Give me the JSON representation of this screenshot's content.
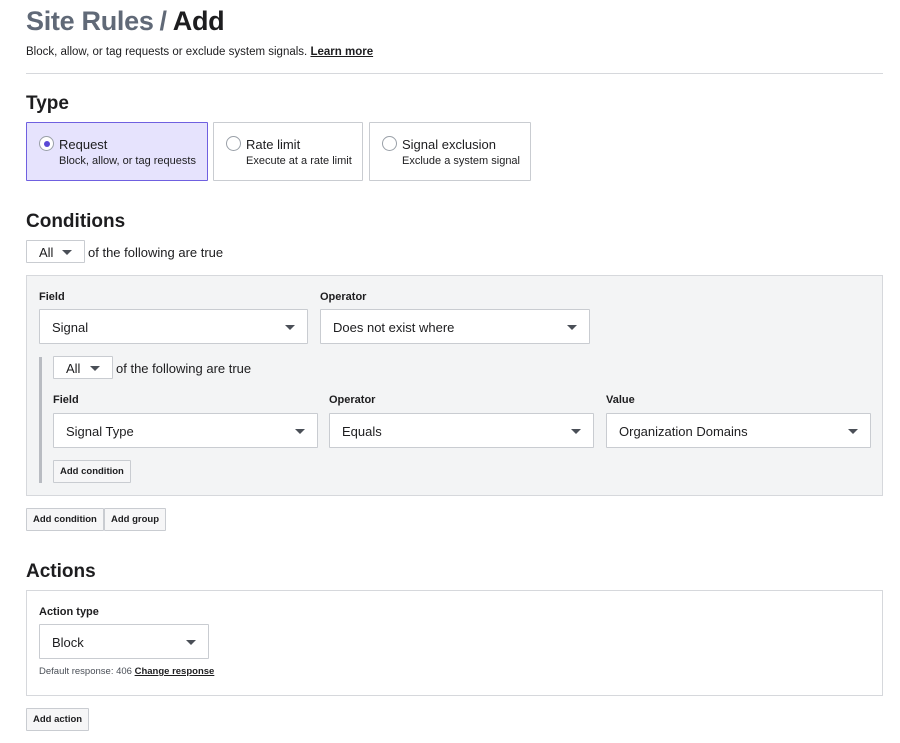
{
  "header": {
    "breadcrumb": "Site Rules",
    "separator": "/",
    "current": "Add",
    "description": "Block, allow, or tag requests or exclude system signals.",
    "learn_more": "Learn more"
  },
  "type_section": {
    "title": "Type",
    "options": [
      {
        "label": "Request",
        "description": "Block, allow, or tag requests",
        "selected": true
      },
      {
        "label": "Rate limit",
        "description": "Execute at a rate limit",
        "selected": false
      },
      {
        "label": "Signal exclusion",
        "description": "Exclude a system signal",
        "selected": false
      }
    ]
  },
  "conditions": {
    "title": "Conditions",
    "match_select": "All",
    "match_text": "of the following are true",
    "condition": {
      "field_label": "Field",
      "field_value": "Signal",
      "operator_label": "Operator",
      "operator_value": "Does not exist where",
      "group": {
        "match_select": "All",
        "match_text": "of the following are true",
        "field_label": "Field",
        "field_value": "Signal Type",
        "operator_label": "Operator",
        "operator_value": "Equals",
        "value_label": "Value",
        "value_value": "Organization Domains",
        "add_condition": "Add condition"
      }
    },
    "add_condition": "Add condition",
    "add_group": "Add group"
  },
  "actions": {
    "title": "Actions",
    "action_type_label": "Action type",
    "action_type_value": "Block",
    "default_response_text": "Default response: 406",
    "change_response": "Change response",
    "add_action": "Add action"
  },
  "colors": {
    "selected_card_bg": "#e6e3fd",
    "selected_card_border": "#6f60e0",
    "radio_dot": "#5b4ad6",
    "breadcrumb": "#606977"
  }
}
